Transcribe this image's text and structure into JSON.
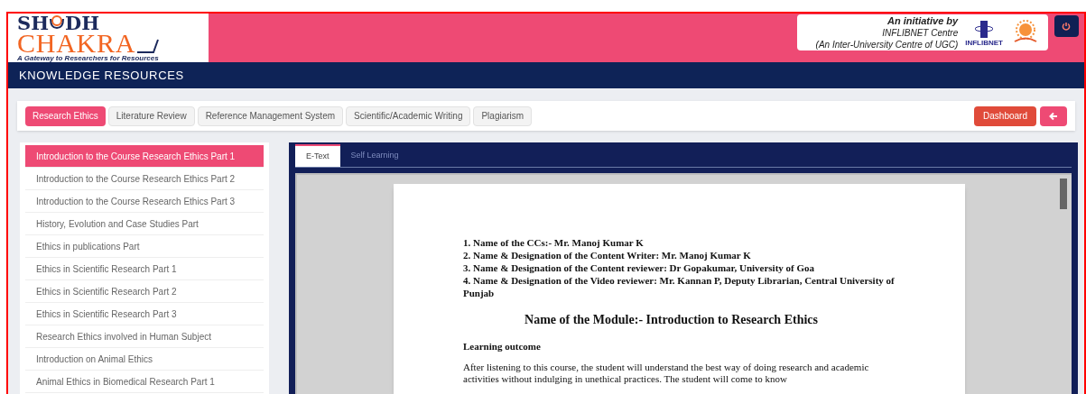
{
  "logo": {
    "title_start": "SH",
    "title_end": "DH",
    "subtitle": "CHAKRA",
    "tagline": "A Gateway to Researchers for Resources"
  },
  "initiative": {
    "lines": [
      "An initiative by",
      "INFLIBNET Centre",
      "(An Inter-University Centre of UGC)"
    ],
    "emblem_label": "INFLIBNET"
  },
  "section_title": "KNOWLEDGE RESOURCES",
  "tabs": [
    {
      "label": "Research Ethics",
      "selected": true
    },
    {
      "label": "Literature Review",
      "selected": false
    },
    {
      "label": "Reference Management System",
      "selected": false
    },
    {
      "label": "Scientific/Academic Writing",
      "selected": false
    },
    {
      "label": "Plagiarism",
      "selected": false
    }
  ],
  "dashboard_button": "Dashboard",
  "sidebar": {
    "items": [
      {
        "label": "Introduction to the Course Research Ethics Part 1",
        "selected": true
      },
      {
        "label": "Introduction to the Course Research Ethics Part 2",
        "selected": false
      },
      {
        "label": "Introduction to the Course Research Ethics Part 3",
        "selected": false
      },
      {
        "label": "History, Evolution and Case Studies Part",
        "selected": false
      },
      {
        "label": "Ethics in publications Part",
        "selected": false
      },
      {
        "label": "Ethics in Scientific Research Part 1",
        "selected": false
      },
      {
        "label": "Ethics in Scientific Research Part 2",
        "selected": false
      },
      {
        "label": "Ethics in Scientific Research Part 3",
        "selected": false
      },
      {
        "label": "Research Ethics involved in Human Subject",
        "selected": false
      },
      {
        "label": "Introduction on Animal Ethics",
        "selected": false
      },
      {
        "label": "Animal Ethics in Biomedical Research Part 1",
        "selected": false
      }
    ]
  },
  "viewer": {
    "tabs": [
      {
        "label": "E-Text",
        "selected": true
      },
      {
        "label": "Self Learning",
        "selected": false
      }
    ],
    "document": {
      "credits": [
        "1. Name of the CCs:- Mr. Manoj Kumar K",
        "2. Name & Designation of the Content Writer: Mr. Manoj Kumar K",
        "3. Name & Designation of the Content reviewer: Dr Gopakumar, University of Goa",
        "4. Name & Designation of the Video reviewer: Mr. Kannan P, Deputy Librarian, Central University of Punjab"
      ],
      "module_title": "Name of the Module:- Introduction to Research Ethics",
      "heading": "Learning outcome",
      "paragraph": "After listening to this course, the student will understand the best way of doing research and academic activities without indulging in unethical practices. The student will come to know"
    }
  }
}
